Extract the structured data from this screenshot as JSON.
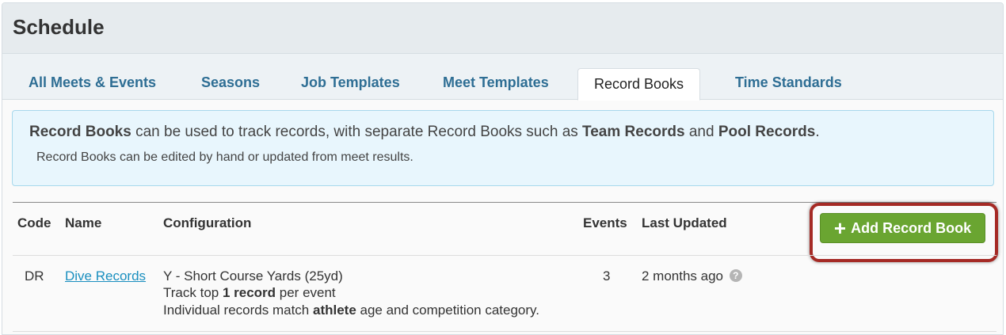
{
  "header": {
    "title": "Schedule"
  },
  "tabs": [
    {
      "label": "All Meets & Events"
    },
    {
      "label": "Seasons"
    },
    {
      "label": "Job Templates"
    },
    {
      "label": "Meet Templates"
    },
    {
      "label": "Record Books",
      "active": true
    },
    {
      "label": "Time Standards"
    }
  ],
  "info": {
    "line1": {
      "b1": "Record Books",
      "t1": " can be used to track records, with separate Record Books such as ",
      "b2": "Team Records",
      "t2": " and ",
      "b3": "Pool Records",
      "t3": "."
    },
    "line2": "Record Books can be edited by hand or updated from meet results."
  },
  "table": {
    "columns": {
      "code": "Code",
      "name": "Name",
      "configuration": "Configuration",
      "events": "Events",
      "last_updated": "Last Updated"
    },
    "add_button_label": "Add Record Book",
    "rows": [
      {
        "code": "DR",
        "name": "Dive Records",
        "config_line1": "Y - Short Course Yards (25yd)",
        "config_line2": {
          "pre": "Track top ",
          "bold": "1 record",
          "post": " per event"
        },
        "config_line3": {
          "pre": "Individual records match ",
          "bold": "athlete",
          "post": " age and competition category."
        },
        "events": "3",
        "last_updated": "2 months ago"
      }
    ]
  },
  "colors": {
    "accent_link": "#2e6e94",
    "button_green": "#6aa531",
    "highlight_ring": "#a52a25",
    "info_bg": "#e8f6fd"
  },
  "icons": {
    "add": "plus-icon",
    "help": "question-circle-icon"
  }
}
